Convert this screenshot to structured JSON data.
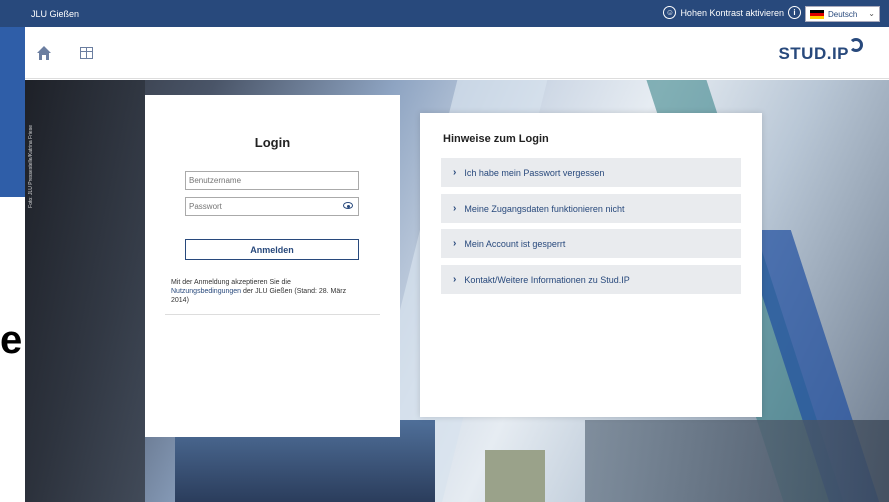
{
  "topbar": {
    "site_name": "JLU Gießen",
    "contrast_label": "Hohen Kontrast aktivieren",
    "language": "Deutsch"
  },
  "header": {
    "logo": "STUD.IP"
  },
  "background": {
    "photo_credit": "Foto: JLU Pressestelle/Katrina Friese",
    "behind_letter": "e"
  },
  "login": {
    "title": "Login",
    "username_placeholder": "Benutzername",
    "password_placeholder": "Passwort",
    "submit_label": "Anmelden",
    "terms_prefix": "Mit der Anmeldung akzeptieren Sie die ",
    "terms_link": "Nutzungsbedingungen",
    "terms_suffix": " der JLU Gießen (Stand: 28. März 2014)"
  },
  "hints": {
    "title": "Hinweise zum Login",
    "items": [
      "Ich habe mein Passwort vergessen",
      "Meine Zugangsdaten funktionieren nicht",
      "Mein Account ist gesperrt",
      "Kontakt/Weitere Informationen zu Stud.IP"
    ]
  },
  "colors": {
    "brand": "#28497c",
    "hint_bg": "#e9ebee"
  }
}
